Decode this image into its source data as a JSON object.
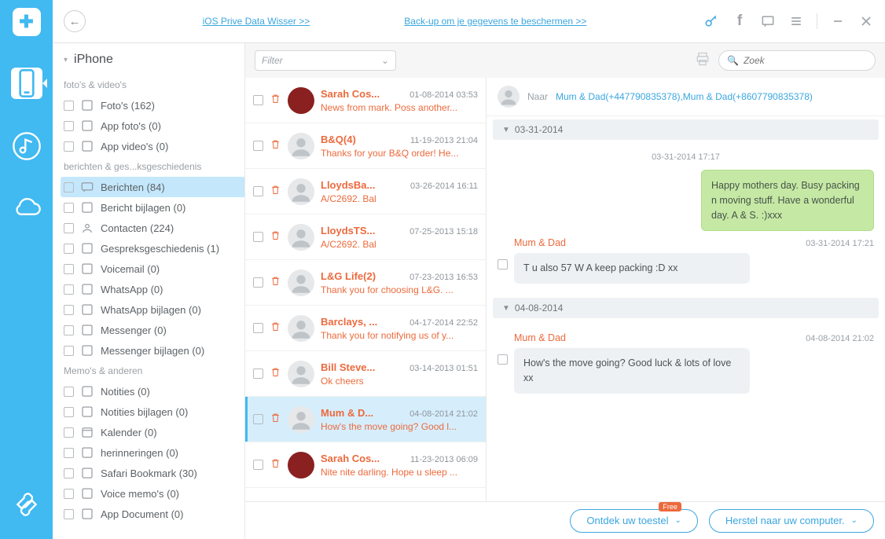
{
  "header": {
    "link1": "iOS Prive Data Wisser >>",
    "link2": "Back-up om je gegevens te beschermen >>"
  },
  "tree": {
    "root": "iPhone",
    "sections": [
      {
        "title": "foto's & video's",
        "items": [
          {
            "icon": "photos",
            "label": "Foto's (162)"
          },
          {
            "icon": "app-photos",
            "label": "App foto's (0)"
          },
          {
            "icon": "app-videos",
            "label": "App video's (0)"
          }
        ]
      },
      {
        "title": "berichten & ges...ksgeschiedenis",
        "items": [
          {
            "icon": "messages",
            "label": "Berichten (84)",
            "active": true
          },
          {
            "icon": "attachments",
            "label": "Bericht bijlagen (0)"
          },
          {
            "icon": "contacts",
            "label": "Contacten (224)"
          },
          {
            "icon": "call-history",
            "label": "Gespreksgeschiedenis (1)"
          },
          {
            "icon": "voicemail",
            "label": "Voicemail (0)"
          },
          {
            "icon": "whatsapp",
            "label": "WhatsApp (0)"
          },
          {
            "icon": "whatsapp-att",
            "label": "WhatsApp bijlagen (0)"
          },
          {
            "icon": "messenger",
            "label": "Messenger (0)"
          },
          {
            "icon": "messenger-att",
            "label": "Messenger bijlagen (0)"
          }
        ]
      },
      {
        "title": "Memo's & anderen",
        "items": [
          {
            "icon": "notes",
            "label": "Notities (0)"
          },
          {
            "icon": "notes-att",
            "label": "Notities bijlagen (0)"
          },
          {
            "icon": "calendar",
            "label": "Kalender (0)"
          },
          {
            "icon": "reminders",
            "label": "herinneringen (0)"
          },
          {
            "icon": "safari",
            "label": "Safari Bookmark (30)"
          },
          {
            "icon": "voice-memo",
            "label": "Voice memo's (0)"
          },
          {
            "icon": "app-doc",
            "label": "App Document (0)"
          }
        ]
      }
    ]
  },
  "toolbar": {
    "filter_placeholder": "Filter",
    "search_placeholder": "Zoek"
  },
  "conversations": [
    {
      "name": "Sarah Cos...",
      "time": "01-08-2014 03:53",
      "preview": "News from mark. Poss another...",
      "avatar": "red"
    },
    {
      "name": "B&Q(4)",
      "time": "11-19-2013 21:04",
      "preview": "Thanks for your B&Q order! He..."
    },
    {
      "name": "LloydsBa...",
      "time": "03-26-2014 16:11",
      "preview": "A/C2692. Bal"
    },
    {
      "name": "LloydsTS...",
      "time": "07-25-2013 15:18",
      "preview": "A/C2692. Bal"
    },
    {
      "name": "L&G Life(2)",
      "time": "07-23-2013 16:53",
      "preview": "Thank you for choosing L&G. ..."
    },
    {
      "name": "Barclays, ...",
      "time": "04-17-2014 22:52",
      "preview": "Thank you for notifying us of y..."
    },
    {
      "name": "Bill Steve...",
      "time": "03-14-2013 01:51",
      "preview": "Ok cheers"
    },
    {
      "name": "Mum & D...",
      "time": "04-08-2014 21:02",
      "preview": "How's the move going? Good l...",
      "active": true
    },
    {
      "name": "Sarah Cos...",
      "time": "11-23-2013 06:09",
      "preview": "Nite nite darling. Hope u sleep ...",
      "avatar": "red"
    }
  ],
  "chat": {
    "to_label": "Naar",
    "to": "Mum & Dad(+447790835378),Mum & Dad(+8607790835378)",
    "groups": [
      {
        "date": "03-31-2014",
        "messages": [
          {
            "type": "out",
            "time": "03-31-2014 17:17",
            "text": "Happy mothers day. Busy packing n moving stuff. Have a wonderful day. A & S. :)xxx"
          },
          {
            "type": "in",
            "sender": "Mum & Dad",
            "time": "03-31-2014 17:21",
            "text": "T u also 57 W A keep packing :D xx"
          }
        ]
      },
      {
        "date": "04-08-2014",
        "messages": [
          {
            "type": "in",
            "sender": "Mum & Dad",
            "time": "04-08-2014 21:02",
            "text": "How's the move going? Good luck & lots of love xx"
          }
        ]
      }
    ]
  },
  "footer": {
    "btn1": "Ontdek uw toestel",
    "badge1": "Free",
    "btn2": "Herstel naar uw computer."
  }
}
